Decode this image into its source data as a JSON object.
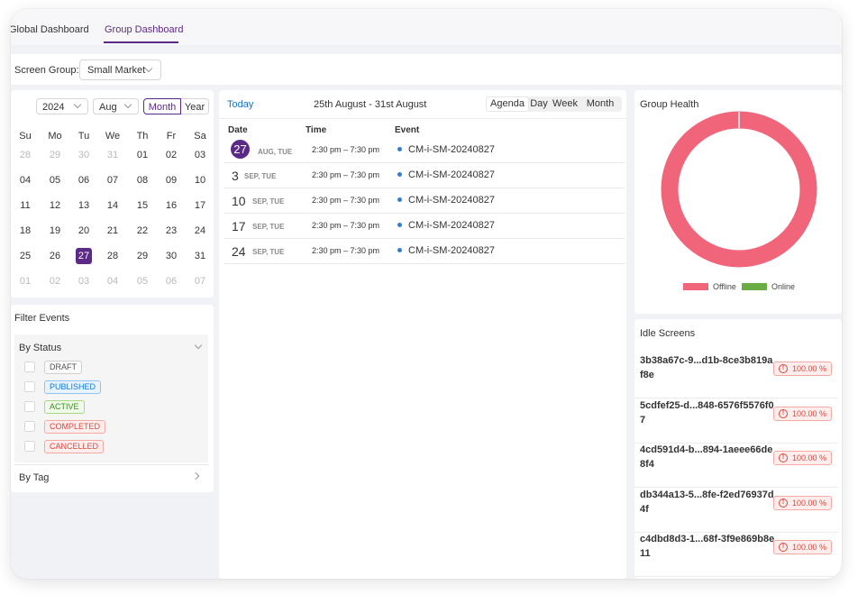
{
  "tabs": {
    "global": "Global Dashboard",
    "group": "Group Dashboard"
  },
  "screen_group": {
    "label": "Screen Group:",
    "value": "Small Market"
  },
  "calendar": {
    "year": "2024",
    "month": "Aug",
    "mode_month": "Month",
    "mode_year": "Year",
    "weekdays": [
      "Su",
      "Mo",
      "Tu",
      "We",
      "Th",
      "Fr",
      "Sa"
    ],
    "weeks": [
      [
        "28",
        "29",
        "30",
        "31",
        "01",
        "02",
        "03"
      ],
      [
        "04",
        "05",
        "06",
        "07",
        "08",
        "09",
        "10"
      ],
      [
        "11",
        "12",
        "13",
        "14",
        "15",
        "16",
        "17"
      ],
      [
        "18",
        "19",
        "20",
        "21",
        "22",
        "23",
        "24"
      ],
      [
        "25",
        "26",
        "27",
        "28",
        "29",
        "30",
        "31"
      ],
      [
        "01",
        "02",
        "03",
        "04",
        "05",
        "06",
        "07"
      ]
    ],
    "selected_day": "27"
  },
  "filter": {
    "title": "Filter Events",
    "by_status": "By Status",
    "statuses": [
      "DRAFT",
      "PUBLISHED",
      "ACTIVE",
      "COMPLETED",
      "CANCELLED"
    ],
    "by_tag": "By Tag"
  },
  "agenda": {
    "today": "Today",
    "range": "25th August - 31st August",
    "views": [
      "Agenda",
      "Day",
      "Week",
      "Month"
    ],
    "columns": {
      "date": "Date",
      "time": "Time",
      "event": "Event"
    },
    "rows": [
      {
        "day": "27",
        "weekday": "AUG, TUE",
        "time": "2:30 pm – 7:30 pm",
        "event": "CM-i-SM-20240827",
        "highlight": true
      },
      {
        "day": "3",
        "weekday": "SEP, TUE",
        "time": "2:30 pm – 7:30 pm",
        "event": "CM-i-SM-20240827",
        "highlight": false
      },
      {
        "day": "10",
        "weekday": "SEP, TUE",
        "time": "2:30 pm – 7:30 pm",
        "event": "CM-i-SM-20240827",
        "highlight": false
      },
      {
        "day": "17",
        "weekday": "SEP, TUE",
        "time": "2:30 pm – 7:30 pm",
        "event": "CM-i-SM-20240827",
        "highlight": false
      },
      {
        "day": "24",
        "weekday": "SEP, TUE",
        "time": "2:30 pm – 7:30 pm",
        "event": "CM-i-SM-20240827",
        "highlight": false
      }
    ]
  },
  "health": {
    "title": "Group Health",
    "offline_label": "Offline",
    "online_label": "Online",
    "offline_fraction": 1.0,
    "online_fraction": 0.0,
    "colors": {
      "offline": "#f0657a",
      "online": "#6aad45"
    }
  },
  "idle": {
    "title": "Idle Screens",
    "items": [
      {
        "id": "3b38a67c-9...d1b-8ce3b819af8e",
        "pct": "100.00 %"
      },
      {
        "id": "5cdfef25-d...848-6576f5576f07",
        "pct": "100.00 %"
      },
      {
        "id": "4cd591d4-b...894-1aeee66de8f4",
        "pct": "100.00 %"
      },
      {
        "id": "db344a13-5...8fe-f2ed76937d4f",
        "pct": "100.00 %"
      },
      {
        "id": "c4dbd8d3-1...68f-3f9e869b8e11",
        "pct": "100.00 %"
      }
    ]
  },
  "accent": "#5b2a86"
}
